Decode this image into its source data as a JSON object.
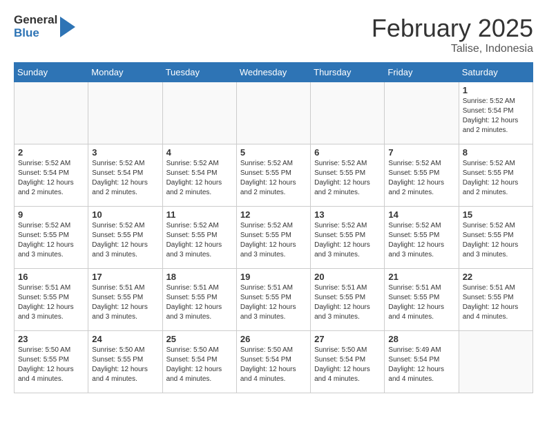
{
  "header": {
    "logo_general": "General",
    "logo_blue": "Blue",
    "month": "February 2025",
    "location": "Talise, Indonesia"
  },
  "days_of_week": [
    "Sunday",
    "Monday",
    "Tuesday",
    "Wednesday",
    "Thursday",
    "Friday",
    "Saturday"
  ],
  "weeks": [
    [
      {
        "day": "",
        "info": ""
      },
      {
        "day": "",
        "info": ""
      },
      {
        "day": "",
        "info": ""
      },
      {
        "day": "",
        "info": ""
      },
      {
        "day": "",
        "info": ""
      },
      {
        "day": "",
        "info": ""
      },
      {
        "day": "1",
        "info": "Sunrise: 5:52 AM\nSunset: 5:54 PM\nDaylight: 12 hours\nand 2 minutes."
      }
    ],
    [
      {
        "day": "2",
        "info": "Sunrise: 5:52 AM\nSunset: 5:54 PM\nDaylight: 12 hours\nand 2 minutes."
      },
      {
        "day": "3",
        "info": "Sunrise: 5:52 AM\nSunset: 5:54 PM\nDaylight: 12 hours\nand 2 minutes."
      },
      {
        "day": "4",
        "info": "Sunrise: 5:52 AM\nSunset: 5:54 PM\nDaylight: 12 hours\nand 2 minutes."
      },
      {
        "day": "5",
        "info": "Sunrise: 5:52 AM\nSunset: 5:55 PM\nDaylight: 12 hours\nand 2 minutes."
      },
      {
        "day": "6",
        "info": "Sunrise: 5:52 AM\nSunset: 5:55 PM\nDaylight: 12 hours\nand 2 minutes."
      },
      {
        "day": "7",
        "info": "Sunrise: 5:52 AM\nSunset: 5:55 PM\nDaylight: 12 hours\nand 2 minutes."
      },
      {
        "day": "8",
        "info": "Sunrise: 5:52 AM\nSunset: 5:55 PM\nDaylight: 12 hours\nand 2 minutes."
      }
    ],
    [
      {
        "day": "9",
        "info": "Sunrise: 5:52 AM\nSunset: 5:55 PM\nDaylight: 12 hours\nand 3 minutes."
      },
      {
        "day": "10",
        "info": "Sunrise: 5:52 AM\nSunset: 5:55 PM\nDaylight: 12 hours\nand 3 minutes."
      },
      {
        "day": "11",
        "info": "Sunrise: 5:52 AM\nSunset: 5:55 PM\nDaylight: 12 hours\nand 3 minutes."
      },
      {
        "day": "12",
        "info": "Sunrise: 5:52 AM\nSunset: 5:55 PM\nDaylight: 12 hours\nand 3 minutes."
      },
      {
        "day": "13",
        "info": "Sunrise: 5:52 AM\nSunset: 5:55 PM\nDaylight: 12 hours\nand 3 minutes."
      },
      {
        "day": "14",
        "info": "Sunrise: 5:52 AM\nSunset: 5:55 PM\nDaylight: 12 hours\nand 3 minutes."
      },
      {
        "day": "15",
        "info": "Sunrise: 5:52 AM\nSunset: 5:55 PM\nDaylight: 12 hours\nand 3 minutes."
      }
    ],
    [
      {
        "day": "16",
        "info": "Sunrise: 5:51 AM\nSunset: 5:55 PM\nDaylight: 12 hours\nand 3 minutes."
      },
      {
        "day": "17",
        "info": "Sunrise: 5:51 AM\nSunset: 5:55 PM\nDaylight: 12 hours\nand 3 minutes."
      },
      {
        "day": "18",
        "info": "Sunrise: 5:51 AM\nSunset: 5:55 PM\nDaylight: 12 hours\nand 3 minutes."
      },
      {
        "day": "19",
        "info": "Sunrise: 5:51 AM\nSunset: 5:55 PM\nDaylight: 12 hours\nand 3 minutes."
      },
      {
        "day": "20",
        "info": "Sunrise: 5:51 AM\nSunset: 5:55 PM\nDaylight: 12 hours\nand 3 minutes."
      },
      {
        "day": "21",
        "info": "Sunrise: 5:51 AM\nSunset: 5:55 PM\nDaylight: 12 hours\nand 4 minutes."
      },
      {
        "day": "22",
        "info": "Sunrise: 5:51 AM\nSunset: 5:55 PM\nDaylight: 12 hours\nand 4 minutes."
      }
    ],
    [
      {
        "day": "23",
        "info": "Sunrise: 5:50 AM\nSunset: 5:55 PM\nDaylight: 12 hours\nand 4 minutes."
      },
      {
        "day": "24",
        "info": "Sunrise: 5:50 AM\nSunset: 5:55 PM\nDaylight: 12 hours\nand 4 minutes."
      },
      {
        "day": "25",
        "info": "Sunrise: 5:50 AM\nSunset: 5:54 PM\nDaylight: 12 hours\nand 4 minutes."
      },
      {
        "day": "26",
        "info": "Sunrise: 5:50 AM\nSunset: 5:54 PM\nDaylight: 12 hours\nand 4 minutes."
      },
      {
        "day": "27",
        "info": "Sunrise: 5:50 AM\nSunset: 5:54 PM\nDaylight: 12 hours\nand 4 minutes."
      },
      {
        "day": "28",
        "info": "Sunrise: 5:49 AM\nSunset: 5:54 PM\nDaylight: 12 hours\nand 4 minutes."
      },
      {
        "day": "",
        "info": ""
      }
    ]
  ]
}
